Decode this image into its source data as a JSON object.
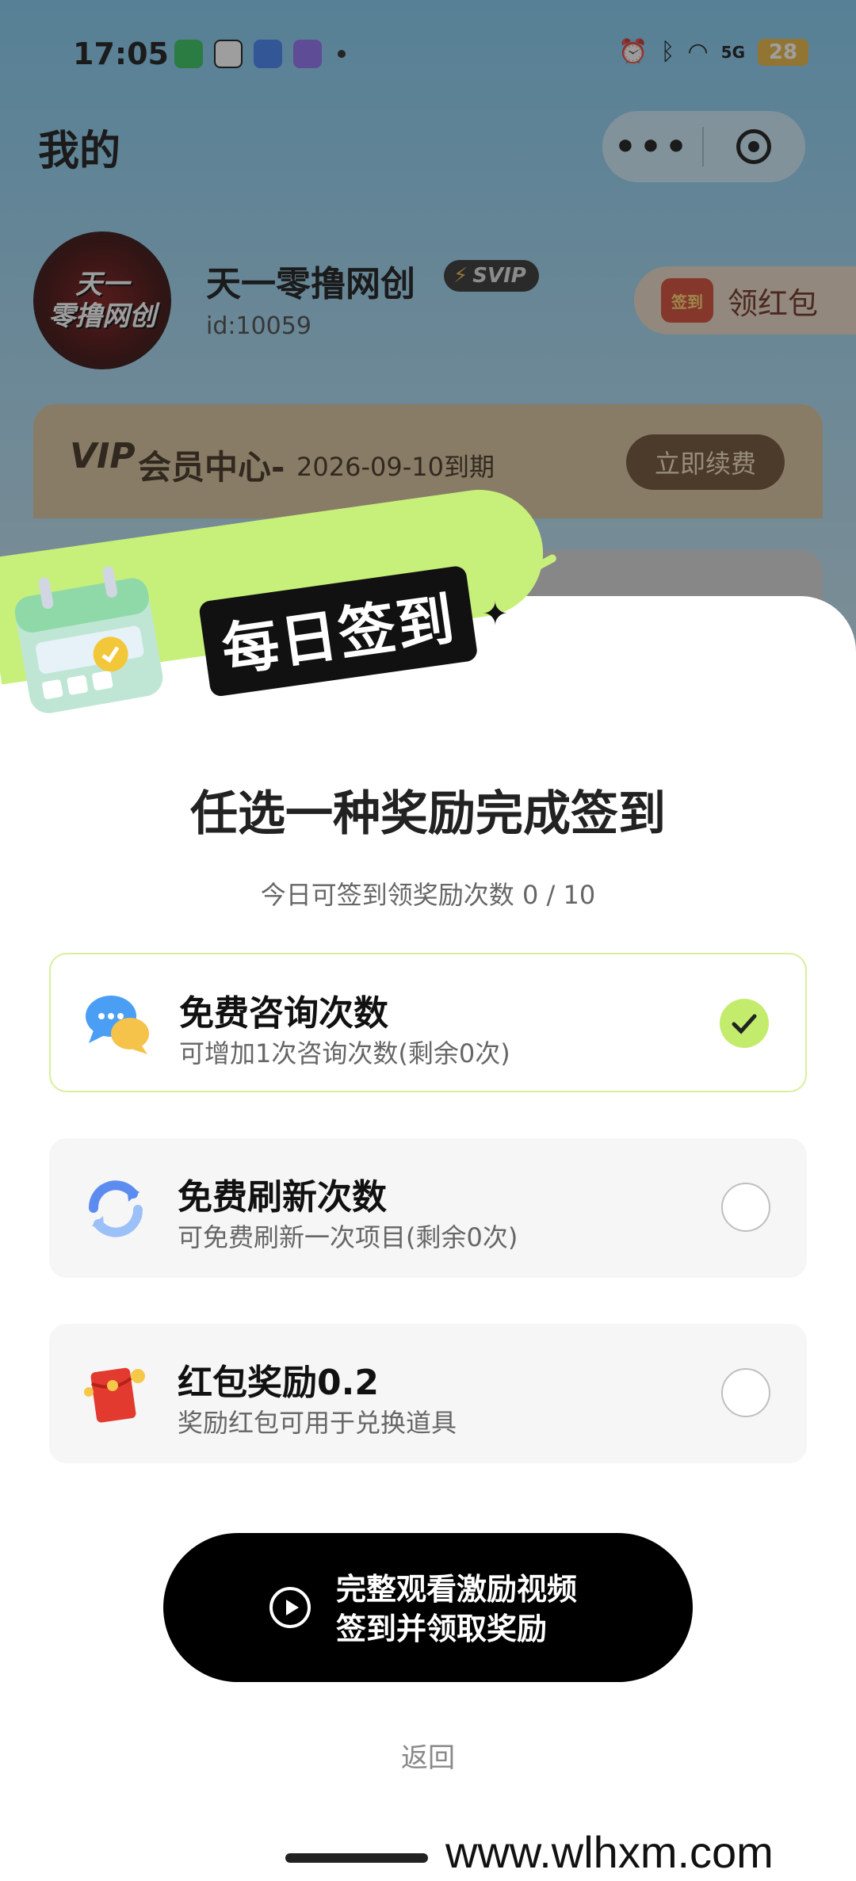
{
  "status_bar": {
    "time": "17:05",
    "battery": "28",
    "network": "5G"
  },
  "header": {
    "title": "我的",
    "more_icon": "more-icon",
    "close_icon": "close-circle-icon"
  },
  "profile": {
    "avatar_text": [
      "天一",
      "零撸网创"
    ],
    "name": "天一零撸网创",
    "badge": "SVIP",
    "id": "id:10059",
    "redpacket_icon_text": "签到",
    "redpacket_label": "领红包"
  },
  "vip": {
    "logo": "VIP",
    "title": "会员中心-",
    "expire": "2026-09-10到期",
    "renew": "立即续费"
  },
  "signin": {
    "banner": "每日签到",
    "title": "任选一种奖励完成签到",
    "subtitle": "今日可签到领奖励次数 0 / 10",
    "options": [
      {
        "title": "免费咨询次数",
        "desc": "可增加1次咨询次数(剩余0次)",
        "icon": "chat-bubbles-icon",
        "selected": true
      },
      {
        "title": "免费刷新次数",
        "desc": "可免费刷新一次项目(剩余0次)",
        "icon": "refresh-icon",
        "selected": false
      },
      {
        "title": "红包奖励0.2",
        "desc": "奖励红包可用于兑换道具",
        "icon": "red-envelope-icon",
        "selected": false
      }
    ],
    "cta_line1": "完整观看激励视频",
    "cta_line2": "签到并领取奖励",
    "back": "返回"
  },
  "watermark": "www.wlhxm.com",
  "colors": {
    "accent": "#c3ec6d",
    "cta": "#000000",
    "vip_bg": "#d9c29a"
  }
}
